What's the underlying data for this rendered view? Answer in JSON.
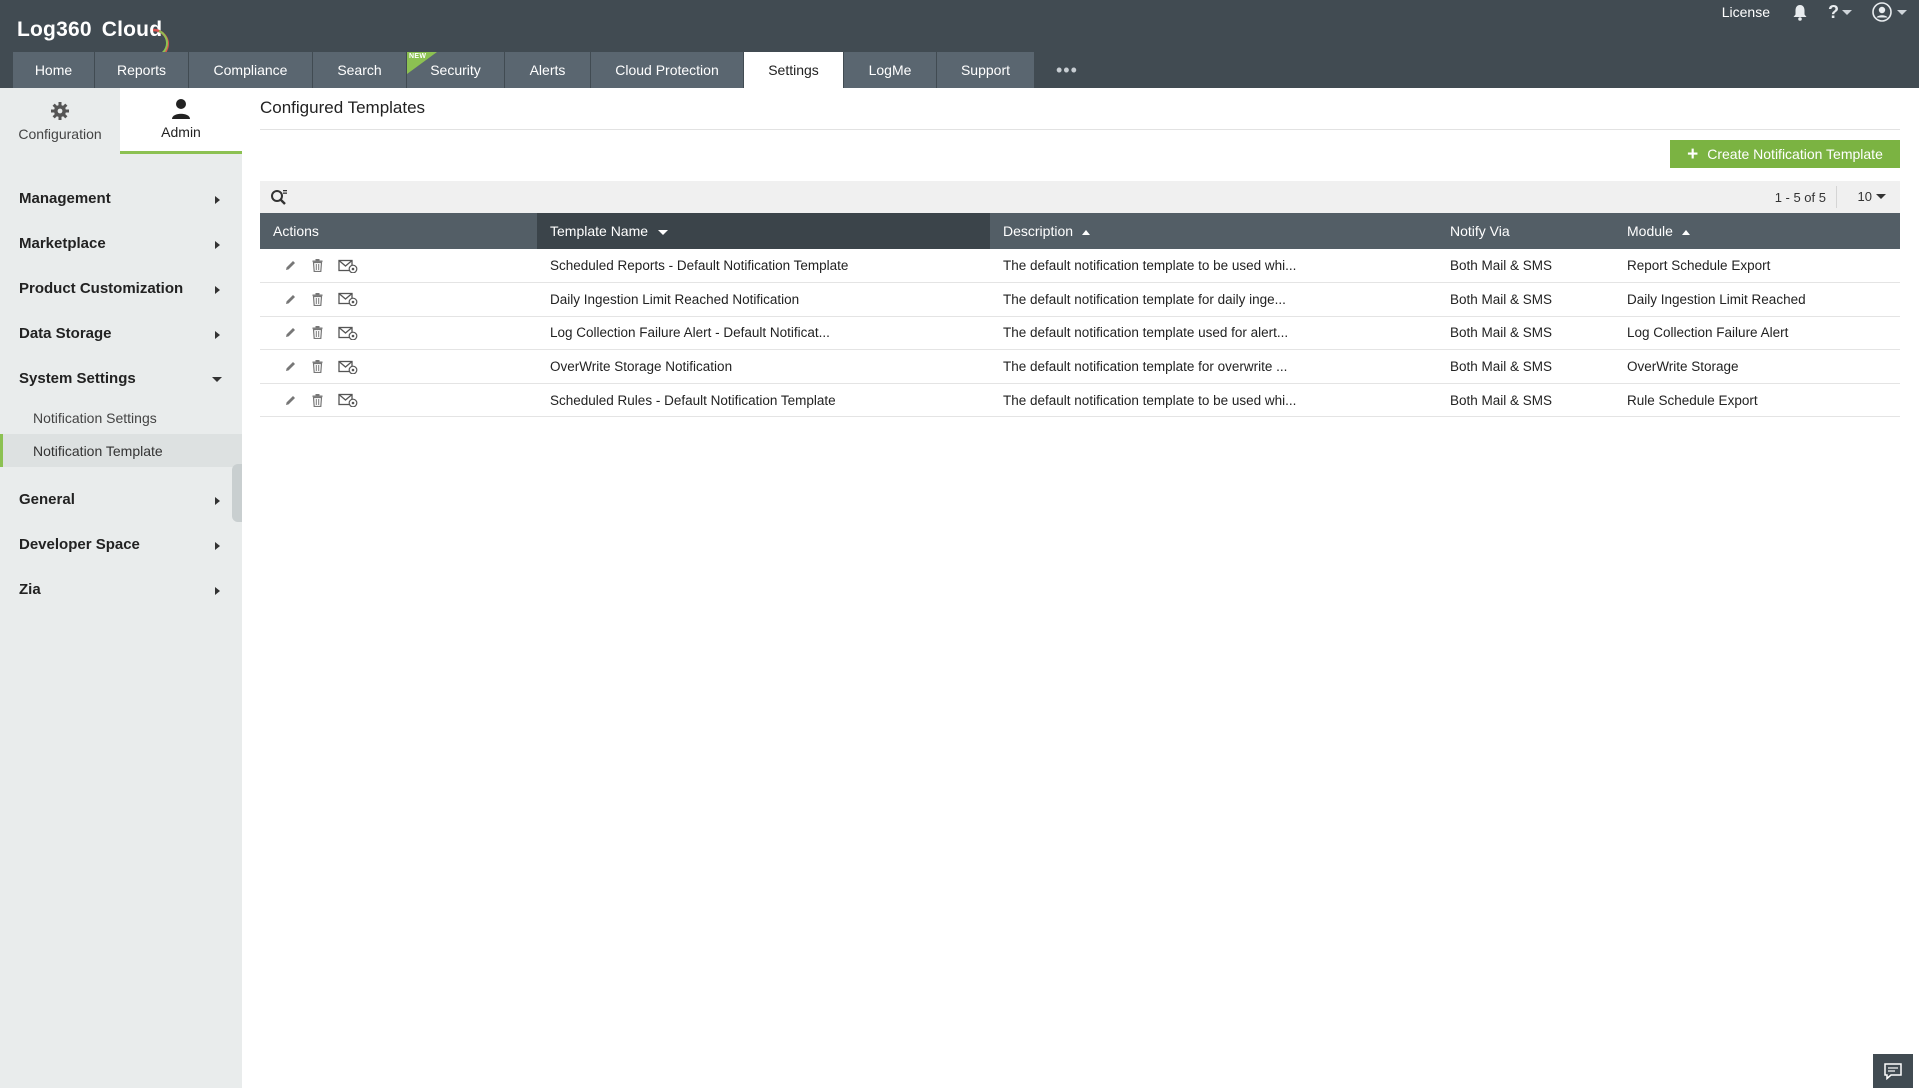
{
  "app": {
    "logo_text": "Log360",
    "logo_sub": "Cloud",
    "license_label": "License",
    "help_label": "?",
    "brand_color": "#8cc152"
  },
  "nav": {
    "tabs": [
      {
        "label": "Home",
        "active": false,
        "is_new": false
      },
      {
        "label": "Reports",
        "active": false,
        "is_new": false
      },
      {
        "label": "Compliance",
        "active": false,
        "is_new": false
      },
      {
        "label": "Search",
        "active": false,
        "is_new": false
      },
      {
        "label": "Security",
        "active": false,
        "is_new": true
      },
      {
        "label": "Alerts",
        "active": false,
        "is_new": false
      },
      {
        "label": "Cloud Protection",
        "active": false,
        "is_new": false
      },
      {
        "label": "Settings",
        "active": true,
        "is_new": false
      },
      {
        "label": "LogMe",
        "active": false,
        "is_new": false
      },
      {
        "label": "Support",
        "active": false,
        "is_new": false
      }
    ],
    "new_badge": "NEW",
    "more_icon": "more-dots-icon"
  },
  "sidebar": {
    "tabs": [
      {
        "label": "Configuration",
        "icon": "gear-icon",
        "active": false
      },
      {
        "label": "Admin",
        "icon": "user-icon",
        "active": true
      }
    ],
    "items": [
      {
        "label": "Management",
        "expanded": false
      },
      {
        "label": "Marketplace",
        "expanded": false
      },
      {
        "label": "Product Customization",
        "expanded": false
      },
      {
        "label": "Data Storage",
        "expanded": false
      },
      {
        "label": "System Settings",
        "expanded": true
      },
      {
        "label": "General",
        "expanded": false
      },
      {
        "label": "Developer Space",
        "expanded": false
      },
      {
        "label": "Zia",
        "expanded": false
      }
    ],
    "system_settings_children": [
      {
        "label": "Notification Settings",
        "active": false
      },
      {
        "label": "Notification Template",
        "active": true
      }
    ]
  },
  "main": {
    "title": "Configured Templates",
    "create_button": "Create Notification Template",
    "pager_text": "1 - 5 of 5",
    "per_page": "10",
    "columns": [
      {
        "label": "Actions",
        "sort": ""
      },
      {
        "label": "Template Name",
        "sort": "desc"
      },
      {
        "label": "Description",
        "sort": "asc"
      },
      {
        "label": "Notify Via",
        "sort": ""
      },
      {
        "label": "Module",
        "sort": "asc"
      }
    ],
    "rows": [
      {
        "name": "Scheduled Reports - Default Notification Template",
        "description": "The default notification template to be used whi...",
        "notify_via": "Both Mail & SMS",
        "module": "Report Schedule Export"
      },
      {
        "name": "Daily Ingestion Limit Reached Notification",
        "description": "The default notification template for daily inge...",
        "notify_via": "Both Mail & SMS",
        "module": "Daily Ingestion Limit Reached"
      },
      {
        "name": "Log Collection Failure Alert - Default Notificat...",
        "description": "The default notification template used for alert...",
        "notify_via": "Both Mail & SMS",
        "module": "Log Collection Failure Alert"
      },
      {
        "name": "OverWrite Storage Notification",
        "description": "The default notification template for overwrite ...",
        "notify_via": "Both Mail & SMS",
        "module": "OverWrite Storage"
      },
      {
        "name": "Scheduled Rules - Default Notification Template",
        "description": "The default notification template to be used whi...",
        "notify_via": "Both Mail & SMS",
        "module": "Rule Schedule Export"
      }
    ]
  }
}
